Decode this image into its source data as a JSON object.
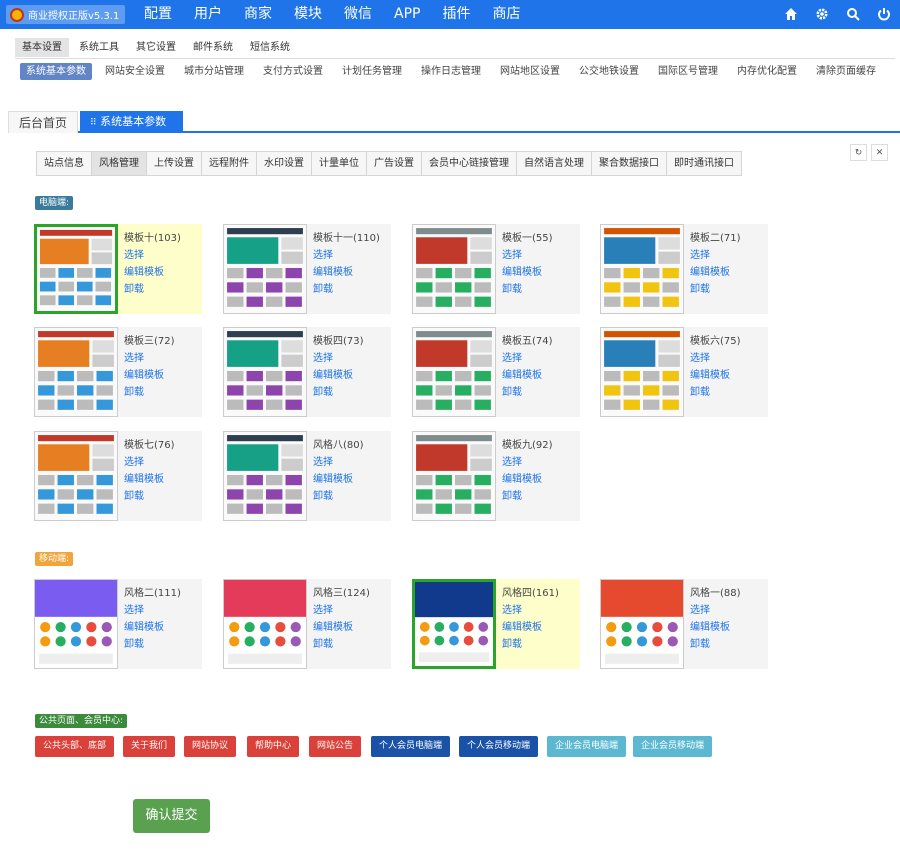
{
  "app": {
    "badge": "商业授权正版v5.3.1",
    "nav": [
      "配置",
      "用户",
      "商家",
      "模块",
      "微信",
      "APP",
      "插件",
      "商店"
    ]
  },
  "menu1": {
    "items": [
      "基本设置",
      "系统工具",
      "其它设置",
      "邮件系统",
      "短信系统"
    ],
    "active": 0
  },
  "menu2": {
    "items": [
      "系统基本参数",
      "网站安全设置",
      "城市分站管理",
      "支付方式设置",
      "计划任务管理",
      "操作日志管理",
      "网站地区设置",
      "公交地铁设置",
      "国际区号管理",
      "内存优化配置",
      "清除页面缓存"
    ],
    "active": 0
  },
  "tabs": {
    "home": "后台首页",
    "current": "系统基本参数",
    "close": "×"
  },
  "config_tabs": {
    "items": [
      "站点信息",
      "风格管理",
      "上传设置",
      "远程附件",
      "水印设置",
      "计量单位",
      "广告设置",
      "会员中心链接管理",
      "自然语言处理",
      "聚合数据接口",
      "即时通讯接口"
    ],
    "active": 1
  },
  "sections": {
    "pc": "电脑端:",
    "mobile": "移动端:",
    "public": "公共页面、会员中心:"
  },
  "actions": {
    "select": "选择",
    "edit": "编辑模板",
    "uninstall": "卸载"
  },
  "pc_templates": [
    {
      "name": "模板十(103)",
      "selected": true
    },
    {
      "name": "模板十一(110)",
      "selected": false
    },
    {
      "name": "模板一(55)",
      "selected": false
    },
    {
      "name": "模板二(71)",
      "selected": false
    },
    {
      "name": "模板三(72)",
      "selected": false
    },
    {
      "name": "模板四(73)",
      "selected": false
    },
    {
      "name": "模板五(74)",
      "selected": false
    },
    {
      "name": "模板六(75)",
      "selected": false
    },
    {
      "name": "模板七(76)",
      "selected": false
    },
    {
      "name": "风格八(80)",
      "selected": false
    },
    {
      "name": "模板九(92)",
      "selected": false
    }
  ],
  "mobile_templates": [
    {
      "name": "风格二(111)",
      "selected": false
    },
    {
      "name": "风格三(124)",
      "selected": false
    },
    {
      "name": "风格四(161)",
      "selected": true
    },
    {
      "name": "风格一(88)",
      "selected": false
    }
  ],
  "public_buttons": [
    {
      "label": "公共头部、底部",
      "color": "#d9413a"
    },
    {
      "label": "关于我们",
      "color": "#d9413a"
    },
    {
      "label": "网站协议",
      "color": "#d9413a"
    },
    {
      "label": "帮助中心",
      "color": "#d9413a"
    },
    {
      "label": "网站公告",
      "color": "#d9413a"
    },
    {
      "label": "个人会员电脑端",
      "color": "#1a52a8"
    },
    {
      "label": "个人会员移动端",
      "color": "#1a52a8"
    },
    {
      "label": "企业会员电脑端",
      "color": "#5bb8d0"
    },
    {
      "label": "企业会员移动端",
      "color": "#5bb8d0"
    }
  ],
  "submit": "确认提交",
  "colors": {
    "primary": "#1e74e8",
    "pc_tag": "#3a7a9a",
    "mobile_tag": "#f0a43a",
    "public_tag": "#3c8a3c",
    "selected_border": "#2aa52a"
  }
}
